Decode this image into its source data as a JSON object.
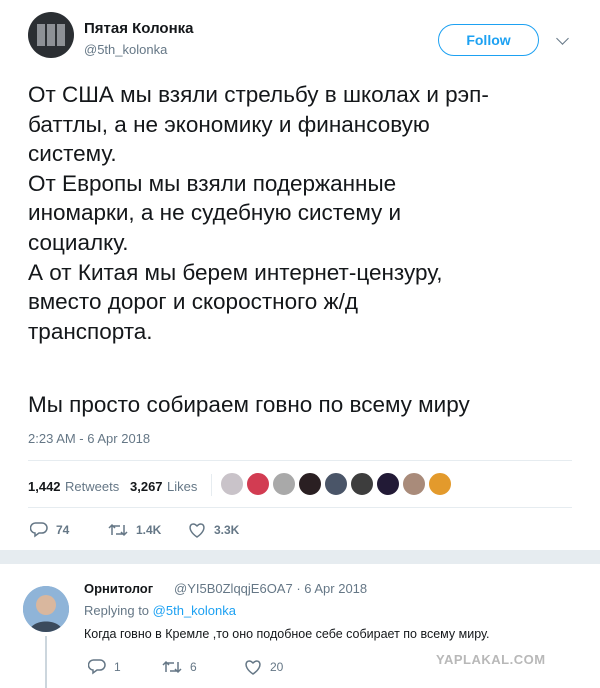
{
  "author": {
    "name": "Пятая Колонка",
    "handle": "@5th_kolonka"
  },
  "follow_label": "Follow",
  "tweet": {
    "text": "От США мы взяли стрельбу в школах и рэп-\nбаттлы, а не экономику и финансовую\nсистему.\nОт Европы мы взяли подержанные\nиномарки, а не судебную систему и\nсоциалку.\nА от Китая мы берем интернет-цензуру,\nвместо дорог и скоростного ж/д\nтранспорта.",
    "last_line": "Мы просто собираем говно по всему миру",
    "timestamp": "2:23 AM - 6 Apr 2018"
  },
  "stats": {
    "retweets_count": "1,442",
    "retweets_label": "Retweets",
    "likes_count": "3,267",
    "likes_label": "Likes"
  },
  "liker_avatars": [
    "#c9c3c9",
    "#d23c52",
    "#a9a9a9",
    "#2a1f22",
    "#4a5568",
    "#3d3d3d",
    "#221a36",
    "#a98b7a",
    "#e39a2c"
  ],
  "actions": {
    "reply_count": "74",
    "retweet_count": "1.4K",
    "like_count": "3.3K"
  },
  "reply": {
    "name": "Орнитолог",
    "handle": "@YI5B0ZlqqjE6OA7 · 6 Apr 2018",
    "replying_to_prefix": "Replying to",
    "replying_to_mention": "@5th_kolonka",
    "text": "Когда говно в Кремле ,то оно подобное себе собирает по всему миру.",
    "reply_count": "1",
    "retweet_count": "6",
    "like_count": "20"
  },
  "watermark": "YAPLAKAL.COM",
  "colors": {
    "accent": "#1da1f2",
    "secondary_text": "#657786",
    "primary_text": "#14171a",
    "divider": "#e6ecf0"
  }
}
